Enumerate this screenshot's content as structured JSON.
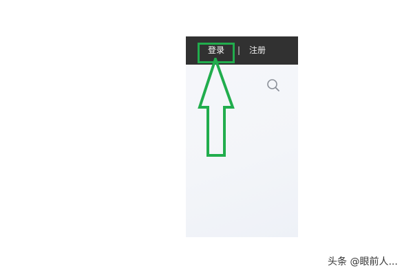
{
  "header": {
    "login_label": "登录",
    "divider": "|",
    "register_label": "注册"
  },
  "icons": {
    "search": "search-icon"
  },
  "annotation": {
    "color": "#21ad4d"
  },
  "watermark": {
    "text": "头条 @眼前人..."
  },
  "colors": {
    "topbar": "#313131",
    "panel": "#f4f6f9",
    "accent": "#21ad4d"
  }
}
